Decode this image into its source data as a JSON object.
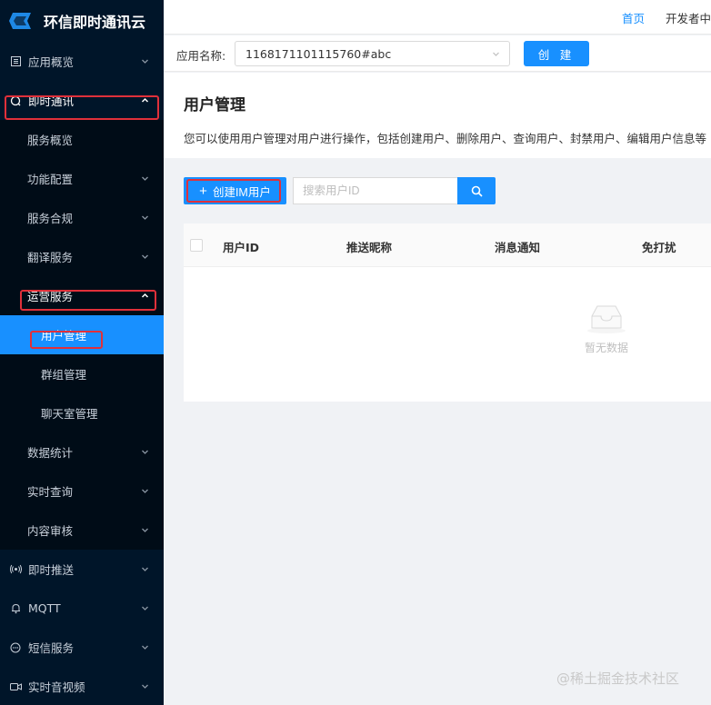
{
  "sidebar": {
    "brand": "环信即时通讯云",
    "items": [
      {
        "label": "应用概览",
        "icon": "doc-icon"
      },
      {
        "label": "即时通讯",
        "icon": "chat-icon"
      },
      {
        "label": "服务概览"
      },
      {
        "label": "功能配置"
      },
      {
        "label": "服务合规"
      },
      {
        "label": "翻译服务"
      },
      {
        "label": "运营服务"
      },
      {
        "label": "用户管理"
      },
      {
        "label": "群组管理"
      },
      {
        "label": "聊天室管理"
      },
      {
        "label": "数据统计"
      },
      {
        "label": "实时查询"
      },
      {
        "label": "内容审核"
      },
      {
        "label": "即时推送",
        "icon": "broadcast-icon"
      },
      {
        "label": "MQTT",
        "icon": "bell-icon"
      },
      {
        "label": "短信服务",
        "icon": "message-icon"
      },
      {
        "label": "实时音视频",
        "icon": "video-icon"
      }
    ]
  },
  "topbar": {
    "home": "首页",
    "dev": "开发者中"
  },
  "appbar": {
    "label": "应用名称:",
    "app_value": "1168171101115760#abc",
    "create_label": "创 建"
  },
  "page": {
    "title": "用户管理",
    "description": "您可以使用用户管理对用户进行操作，包括创建用户、删除用户、查询用户、封禁用户、编辑用户信息等"
  },
  "toolbar": {
    "create_im_label": "创建IM用户",
    "search_placeholder": "搜索用户ID"
  },
  "table": {
    "columns": [
      "用户ID",
      "推送昵称",
      "消息通知",
      "免打扰"
    ],
    "empty_text": "暂无数据"
  },
  "watermark": "@稀土掘金技术社区",
  "colors": {
    "sidebar_bg": "#001529",
    "accent": "#1890ff",
    "highlight": "#e0303a"
  }
}
